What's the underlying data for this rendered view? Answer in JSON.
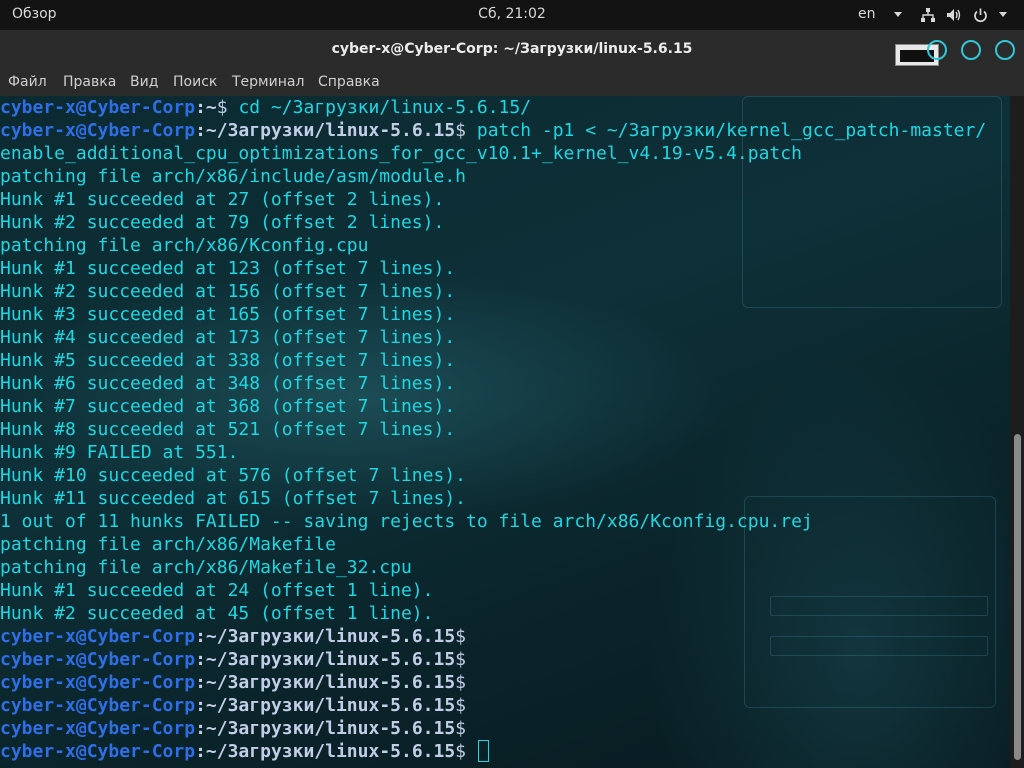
{
  "topbar": {
    "overview_label": "Обзор",
    "clock": "Сб, 21:02",
    "language": "en",
    "tray": {
      "network_icon": "network-icon",
      "volume_icon": "volume-icon",
      "power_icon": "power-icon"
    }
  },
  "window": {
    "title": "cyber-x@Cyber-Corp: ~/Загрузки/linux-5.6.15",
    "accent_color": "#33c6d8"
  },
  "menu": {
    "items": [
      "Файл",
      "Правка",
      "Вид",
      "Поиск",
      "Терминал",
      "Справка"
    ]
  },
  "terminal": {
    "prompt_user": "cyber-x@Cyber-Corp",
    "prompt_sep": ":",
    "prompt_path": "~/Загрузки/linux-5.6.15",
    "prompt_suffix": "$ ",
    "colors": {
      "text": "#1ed7e3",
      "user": "#2e6ee6",
      "path": "#c2cde8"
    },
    "lines": [
      {
        "type": "prompt",
        "path": "~",
        "cmd": "cd ~/Загрузки/linux-5.6.15/"
      },
      {
        "type": "prompt",
        "path": "~/Загрузки/linux-5.6.15",
        "cmd": "patch -p1 < ~/Загрузки/kernel_gcc_patch-master/"
      },
      {
        "type": "output",
        "text": "enable_additional_cpu_optimizations_for_gcc_v10.1+_kernel_v4.19-v5.4.patch"
      },
      {
        "type": "output",
        "text": "patching file arch/x86/include/asm/module.h"
      },
      {
        "type": "output",
        "text": "Hunk #1 succeeded at 27 (offset 2 lines)."
      },
      {
        "type": "output",
        "text": "Hunk #2 succeeded at 79 (offset 2 lines)."
      },
      {
        "type": "output",
        "text": "patching file arch/x86/Kconfig.cpu"
      },
      {
        "type": "output",
        "text": "Hunk #1 succeeded at 123 (offset 7 lines)."
      },
      {
        "type": "output",
        "text": "Hunk #2 succeeded at 156 (offset 7 lines)."
      },
      {
        "type": "output",
        "text": "Hunk #3 succeeded at 165 (offset 7 lines)."
      },
      {
        "type": "output",
        "text": "Hunk #4 succeeded at 173 (offset 7 lines)."
      },
      {
        "type": "output",
        "text": "Hunk #5 succeeded at 338 (offset 7 lines)."
      },
      {
        "type": "output",
        "text": "Hunk #6 succeeded at 348 (offset 7 lines)."
      },
      {
        "type": "output",
        "text": "Hunk #7 succeeded at 368 (offset 7 lines)."
      },
      {
        "type": "output",
        "text": "Hunk #8 succeeded at 521 (offset 7 lines)."
      },
      {
        "type": "output",
        "text": "Hunk #9 FAILED at 551."
      },
      {
        "type": "output",
        "text": "Hunk #10 succeeded at 576 (offset 7 lines)."
      },
      {
        "type": "output",
        "text": "Hunk #11 succeeded at 615 (offset 7 lines)."
      },
      {
        "type": "output",
        "text": "1 out of 11 hunks FAILED -- saving rejects to file arch/x86/Kconfig.cpu.rej"
      },
      {
        "type": "output",
        "text": "patching file arch/x86/Makefile"
      },
      {
        "type": "output",
        "text": "patching file arch/x86/Makefile_32.cpu"
      },
      {
        "type": "output",
        "text": "Hunk #1 succeeded at 24 (offset 1 line)."
      },
      {
        "type": "output",
        "text": "Hunk #2 succeeded at 45 (offset 1 line)."
      },
      {
        "type": "prompt",
        "path": "~/Загрузки/linux-5.6.15",
        "cmd": ""
      },
      {
        "type": "prompt",
        "path": "~/Загрузки/linux-5.6.15",
        "cmd": ""
      },
      {
        "type": "prompt",
        "path": "~/Загрузки/linux-5.6.15",
        "cmd": ""
      },
      {
        "type": "prompt",
        "path": "~/Загрузки/linux-5.6.15",
        "cmd": ""
      },
      {
        "type": "prompt",
        "path": "~/Загрузки/linux-5.6.15",
        "cmd": ""
      },
      {
        "type": "prompt",
        "path": "~/Загрузки/linux-5.6.15",
        "cmd": "",
        "cursor": true
      }
    ]
  }
}
